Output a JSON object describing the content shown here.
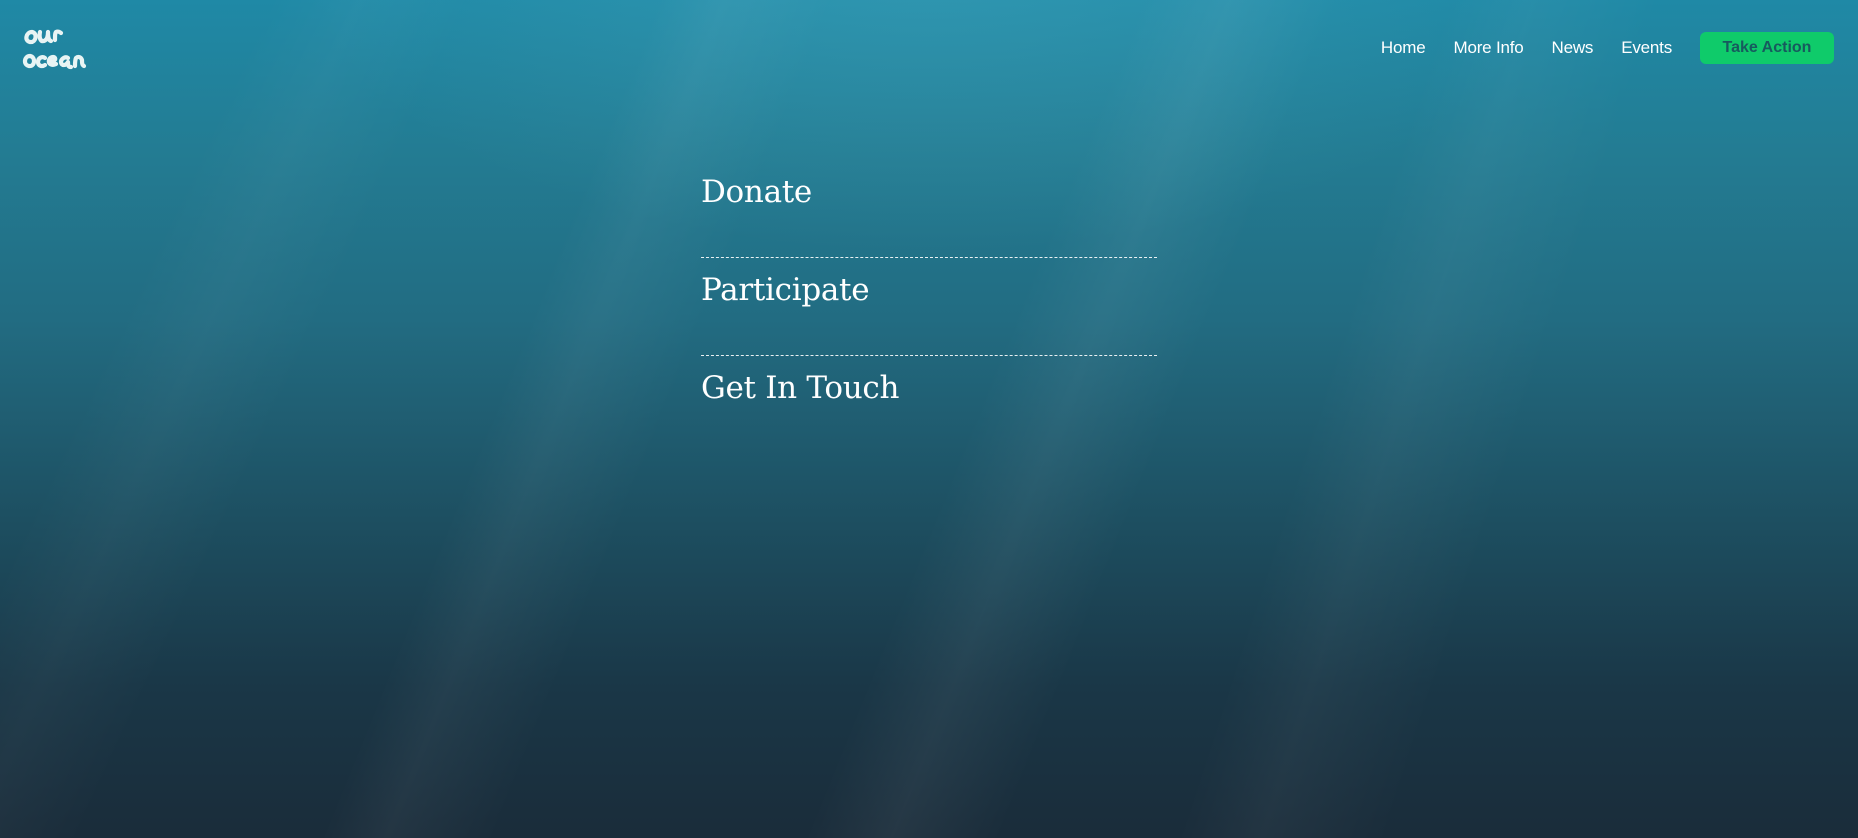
{
  "brand": {
    "logo_text": "our ocean"
  },
  "nav": {
    "links": [
      {
        "label": "Home"
      },
      {
        "label": "More Info"
      },
      {
        "label": "News"
      },
      {
        "label": "Events"
      }
    ],
    "cta_label": "Take Action"
  },
  "menu": {
    "items": [
      {
        "label": "Donate"
      },
      {
        "label": "Participate"
      },
      {
        "label": "Get In Touch"
      }
    ]
  },
  "colors": {
    "accent": "#0fcb6a",
    "accent_text": "#175a5e",
    "background_top": "#1f89a6",
    "background_bottom": "#1a2c3a"
  }
}
